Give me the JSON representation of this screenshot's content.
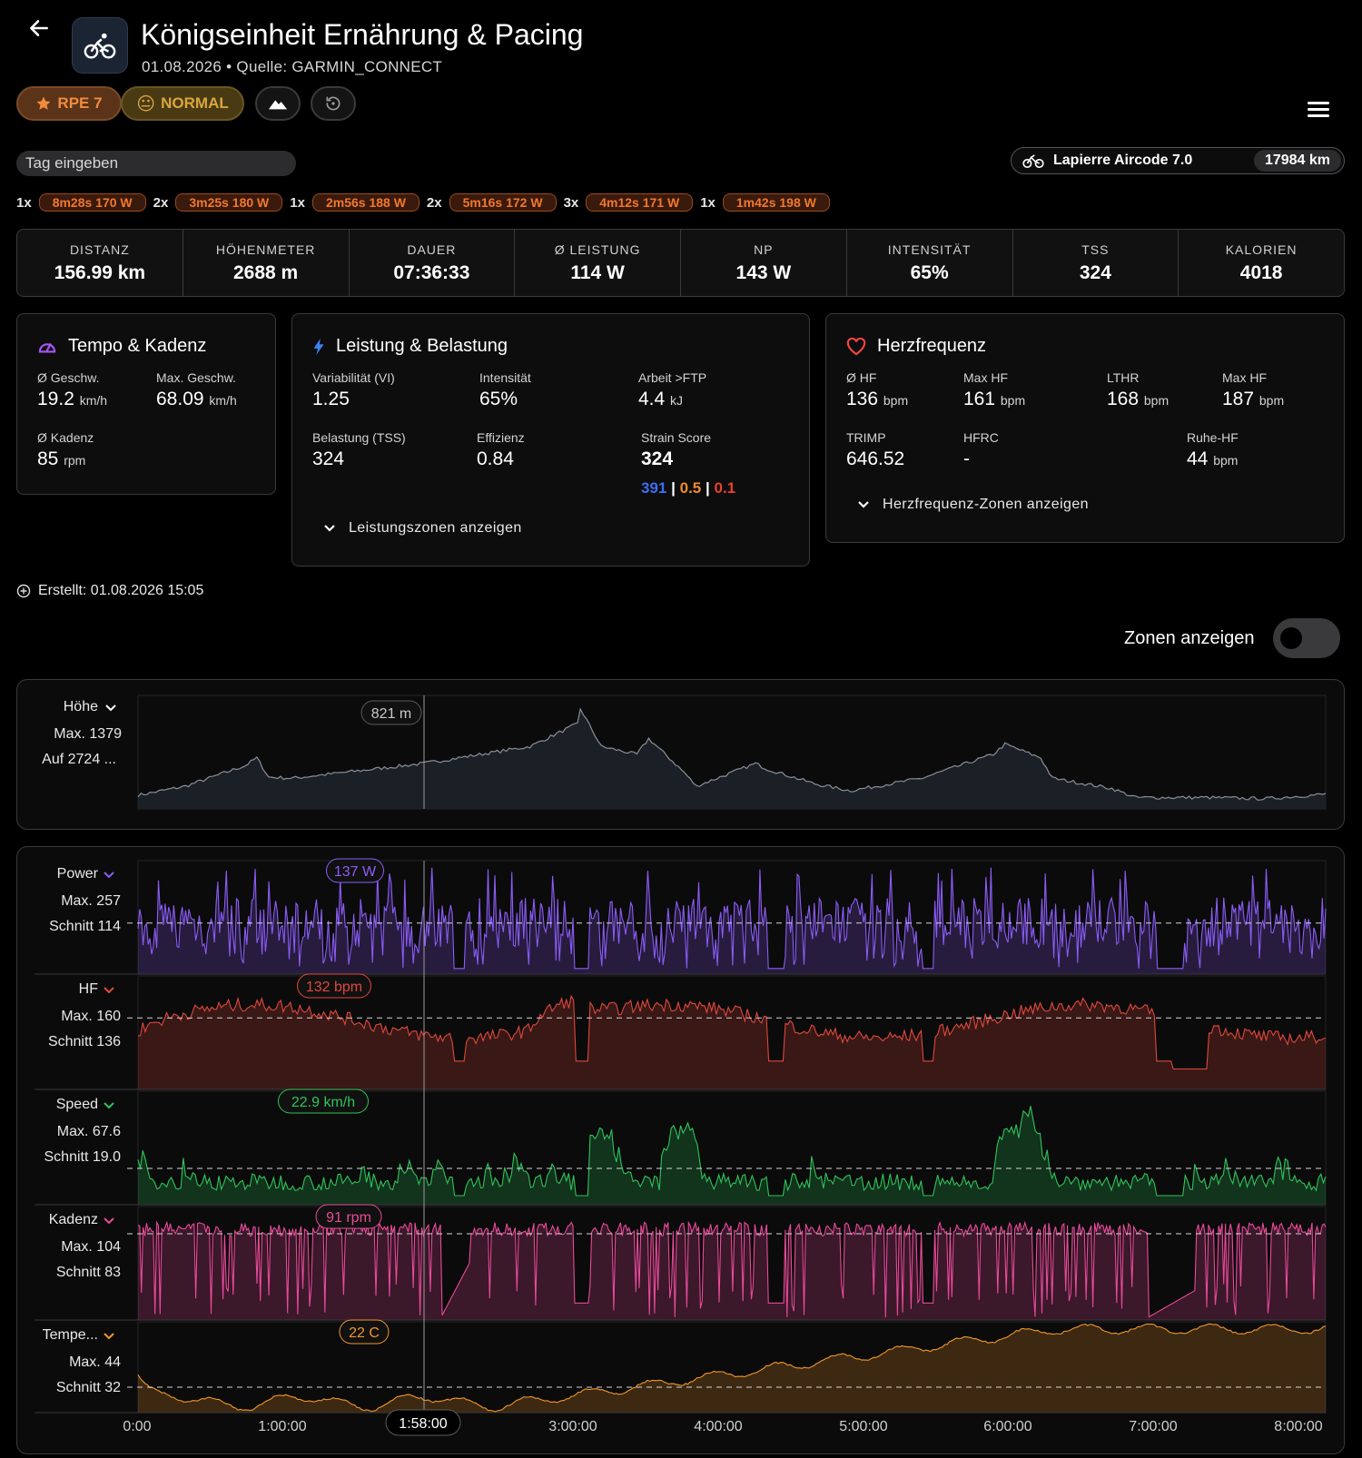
{
  "header": {
    "title": "Königseinheit Ernährung & Pacing",
    "date": "01.08.2026",
    "separator": "•",
    "source": "Quelle: GARMIN_CONNECT"
  },
  "chips": {
    "rpe": "RPE 7",
    "feeling": "NORMAL",
    "feeling_emoji": "😐"
  },
  "tag_input": {
    "placeholder": "Tag eingeben",
    "value": ""
  },
  "bike": {
    "name": "Lapierre Aircode 7.0",
    "km": "17984 km"
  },
  "intervals": [
    {
      "count": "1x",
      "label": "8m28s 170 W"
    },
    {
      "count": "2x",
      "label": "3m25s 180 W"
    },
    {
      "count": "1x",
      "label": "2m56s 188 W"
    },
    {
      "count": "2x",
      "label": "5m16s 172 W"
    },
    {
      "count": "3x",
      "label": "4m12s 171 W"
    },
    {
      "count": "1x",
      "label": "1m42s 198 W"
    }
  ],
  "stats": [
    {
      "label": "DISTANZ",
      "value": "156.99 km"
    },
    {
      "label": "HÖHENMETER",
      "value": "2688 m"
    },
    {
      "label": "DAUER",
      "value": "07:36:33"
    },
    {
      "label": "Ø LEISTUNG",
      "value": "114 W"
    },
    {
      "label": "NP",
      "value": "143 W"
    },
    {
      "label": "INTENSITÄT",
      "value": "65%"
    },
    {
      "label": "TSS",
      "value": "324"
    },
    {
      "label": "KALORIEN",
      "value": "4018"
    }
  ],
  "tempo": {
    "title": "Tempo & Kadenz",
    "avg_speed_label": "Ø Geschw.",
    "avg_speed": "19.2",
    "speed_unit": "km/h",
    "max_speed_label": "Max. Geschw.",
    "max_speed": "68.09",
    "cadence_label": "Ø Kadenz",
    "cadence": "85",
    "cadence_unit": "rpm"
  },
  "power": {
    "title": "Leistung & Belastung",
    "vi_label": "Variabilität (VI)",
    "vi": "1.25",
    "intensity_label": "Intensität",
    "intensity": "65%",
    "work_label": "Arbeit >FTP",
    "work": "4.4",
    "work_unit": "kJ",
    "tss_label": "Belastung (TSS)",
    "tss": "324",
    "efficiency_label": "Effizienz",
    "efficiency": "0.84",
    "strain_label": "Strain Score",
    "strain": "324",
    "strain_a": "391",
    "strain_b": "0.5",
    "strain_c": "0.1",
    "strain_sep": "|",
    "expand": "Leistungszonen anzeigen",
    "colors": {
      "a": "#3b6ff0",
      "b": "#f08a2c",
      "c": "#e8402c"
    }
  },
  "hr": {
    "title": "Herzfrequenz",
    "avg_label": "Ø HF",
    "avg": "136",
    "unit": "bpm",
    "max_label": "Max HF",
    "max": "161",
    "lthr_label": "LTHR",
    "lthr": "168",
    "max2_label": "Max HF",
    "max2": "187",
    "trimp_label": "TRIMP",
    "trimp": "646.52",
    "hfrc_label": "HFRC",
    "hfrc": "-",
    "rest_label": "Ruhe-HF",
    "rest": "44",
    "expand": "Herzfrequenz-Zonen anzeigen"
  },
  "created": "Erstellt: 01.08.2026 15:05",
  "zones_toggle": {
    "label": "Zonen anzeigen",
    "on": false
  },
  "elevation_chart": {
    "name": "Höhe",
    "max": "Max. 1379",
    "ascent": "Auf 2724 ...",
    "tooltip": "821 m",
    "color": "#8a8f99"
  },
  "charts": [
    {
      "key": "power",
      "name": "Power",
      "max": "Max. 257",
      "avg": "Schnitt 114",
      "tooltip": "137 W",
      "color": "#8b5cf6"
    },
    {
      "key": "hf",
      "name": "HF",
      "max": "Max. 160",
      "avg": "Schnitt 136",
      "tooltip": "132 bpm",
      "color": "#e0483c"
    },
    {
      "key": "speed",
      "name": "Speed",
      "max": "Max. 67.6",
      "avg": "Schnitt 19.0",
      "tooltip": "22.9 km/h",
      "color": "#2fc45a"
    },
    {
      "key": "kadenz",
      "name": "Kadenz",
      "max": "Max. 104",
      "avg": "Schnitt 83",
      "tooltip": "91 rpm",
      "color": "#e84a9a"
    },
    {
      "key": "temp",
      "name": "Tempe...",
      "max": "Max. 44",
      "avg": "Schnitt 32",
      "tooltip": "22 C",
      "color": "#f0962c"
    }
  ],
  "time_axis": {
    "ticks": [
      "0:00",
      "1:00:00",
      "3:00:00",
      "4:00:00",
      "5:00:00",
      "6:00:00",
      "7:00:00",
      "8:00:00"
    ],
    "cursor": "1:58:00"
  },
  "icons": {
    "back": "arrow-left-icon",
    "activity": "bicycle-icon",
    "rpe": "star-icon",
    "route": "mountain-icon",
    "history": "history-icon",
    "menu": "hamburger-icon",
    "tempo": "gauge-icon",
    "power": "bolt-icon",
    "hr": "heart-icon"
  }
}
